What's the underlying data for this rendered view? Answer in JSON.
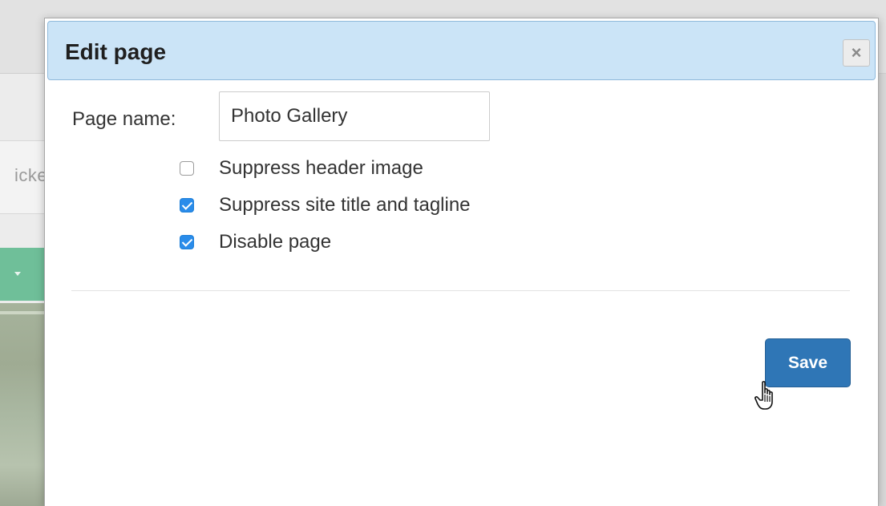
{
  "background": {
    "partial_text": "icke"
  },
  "dialog": {
    "title": "Edit page",
    "close_label": "×",
    "page_name_label": "Page name:",
    "page_name_value": "Photo Gallery",
    "options": [
      {
        "label": "Suppress header image",
        "checked": false
      },
      {
        "label": "Suppress site title and tagline",
        "checked": true
      },
      {
        "label": "Disable page",
        "checked": true
      }
    ],
    "save_label": "Save"
  },
  "colors": {
    "header_bg": "#cbe4f7",
    "checkbox_checked": "#2a8cea",
    "save_button": "#2f76b6",
    "background_green": "#6fbf99"
  },
  "icons": {
    "close": "close-icon",
    "checkmark": "checkmark-icon",
    "cursor": "hand-pointer-icon",
    "dropdown": "caret-down-icon"
  }
}
